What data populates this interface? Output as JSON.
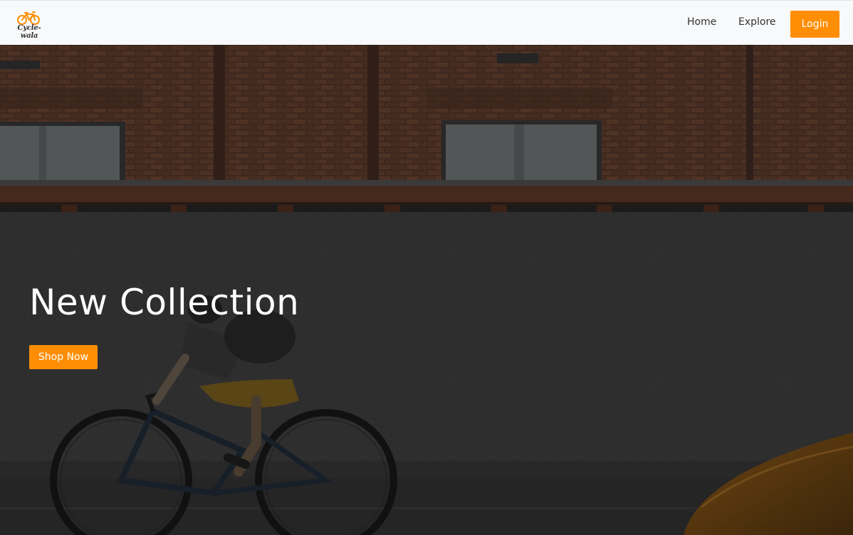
{
  "brand": {
    "name": "Cycle-wala",
    "logo_icon": "bicycle-icon"
  },
  "nav": {
    "home_label": "Home",
    "explore_label": "Explore",
    "login_label": "Login"
  },
  "hero": {
    "title": "New Collection",
    "cta_label": "Shop Now",
    "background": "cyclist-riding-past-brick-building-photo"
  },
  "colors": {
    "accent": "#ff8e05",
    "navbar_bg": "#f8f9fa",
    "nav_text": "#333333",
    "hero_text": "#ffffff"
  }
}
